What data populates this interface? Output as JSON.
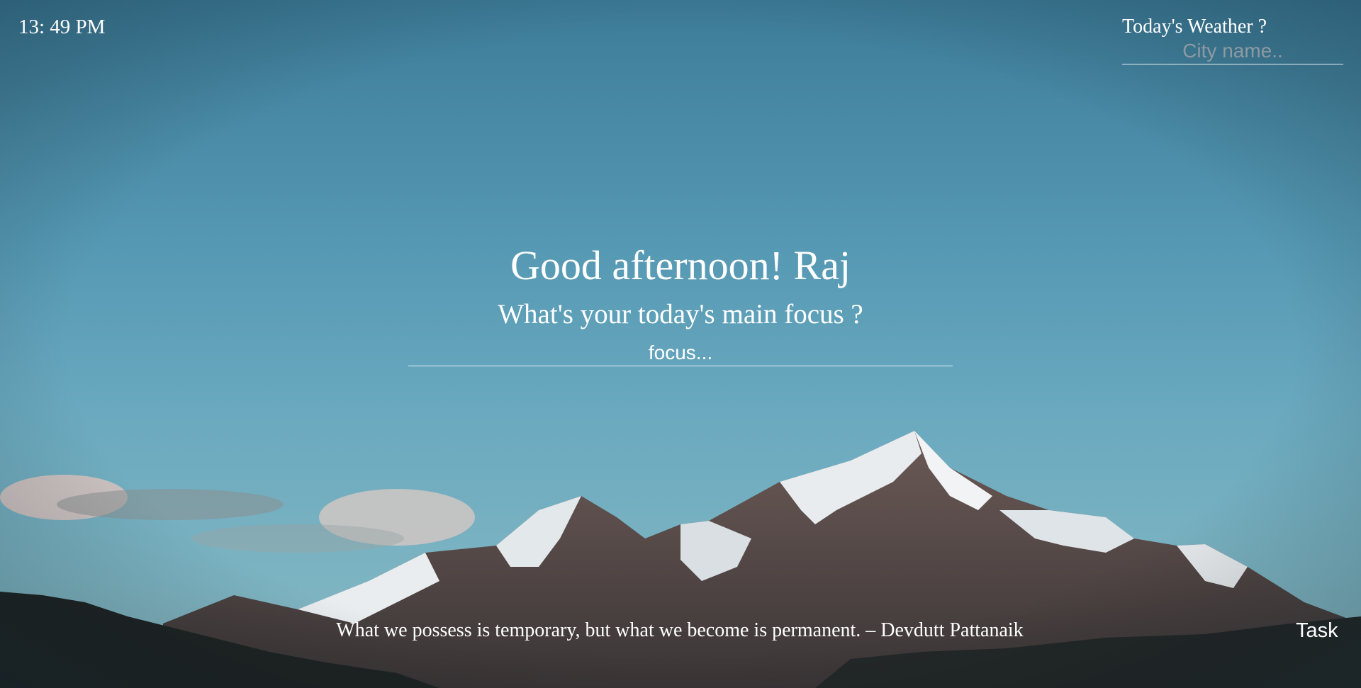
{
  "clock": {
    "time": "13: 49 PM"
  },
  "weather": {
    "title": "Today's Weather ?",
    "city_placeholder": "City name.."
  },
  "main": {
    "greeting": "Good afternoon! Raj",
    "question": "What's your today's main focus ?",
    "focus_placeholder": "focus..."
  },
  "footer": {
    "quote": "What we possess is temporary, but what we become is permanent. – Devdutt Pattanaik",
    "task_label": "Task"
  }
}
